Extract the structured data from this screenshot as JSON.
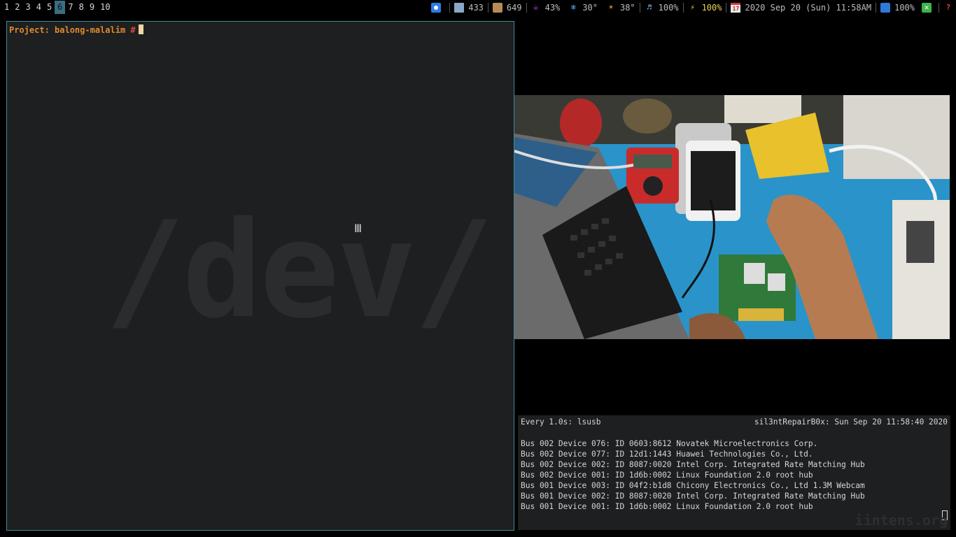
{
  "workspaces": [
    "1",
    "2",
    "3",
    "4",
    "5",
    "6",
    "7",
    "8",
    "9",
    "10"
  ],
  "active_workspace": "6",
  "status": {
    "mem": "433",
    "pkg": "649",
    "cpu": "43%",
    "temp1": "30°",
    "temp2": "38°",
    "volume": "100%",
    "battery": "100%",
    "datetime": "2020 Sep 20 (Sun) 11:58AM",
    "wifi": "100%",
    "cal_icon_text": "17"
  },
  "terminal": {
    "prompt_label": "Project: balong-malalim",
    "prompt_symbol": "#",
    "watermark": "/dev/"
  },
  "watch": {
    "command": "Every 1.0s: lsusb",
    "host_time": "sil3ntRepairB0x: Sun Sep 20 11:58:40 2020",
    "lines": [
      "Bus 002 Device 076: ID 0603:8612 Novatek Microelectronics Corp.",
      "Bus 002 Device 077: ID 12d1:1443 Huawei Technologies Co., Ltd.",
      "Bus 002 Device 002: ID 8087:0020 Intel Corp. Integrated Rate Matching Hub",
      "Bus 002 Device 001: ID 1d6b:0002 Linux Foundation 2.0 root hub",
      "Bus 001 Device 003: ID 04f2:b1d8 Chicony Electronics Co., Ltd 1.3M Webcam",
      "Bus 001 Device 002: ID 8087:0020 Intel Corp. Integrated Rate Matching Hub",
      "Bus 001 Device 001: ID 1d6b:0002 Linux Foundation 2.0 root hub"
    ],
    "brand": "iintens.org"
  }
}
